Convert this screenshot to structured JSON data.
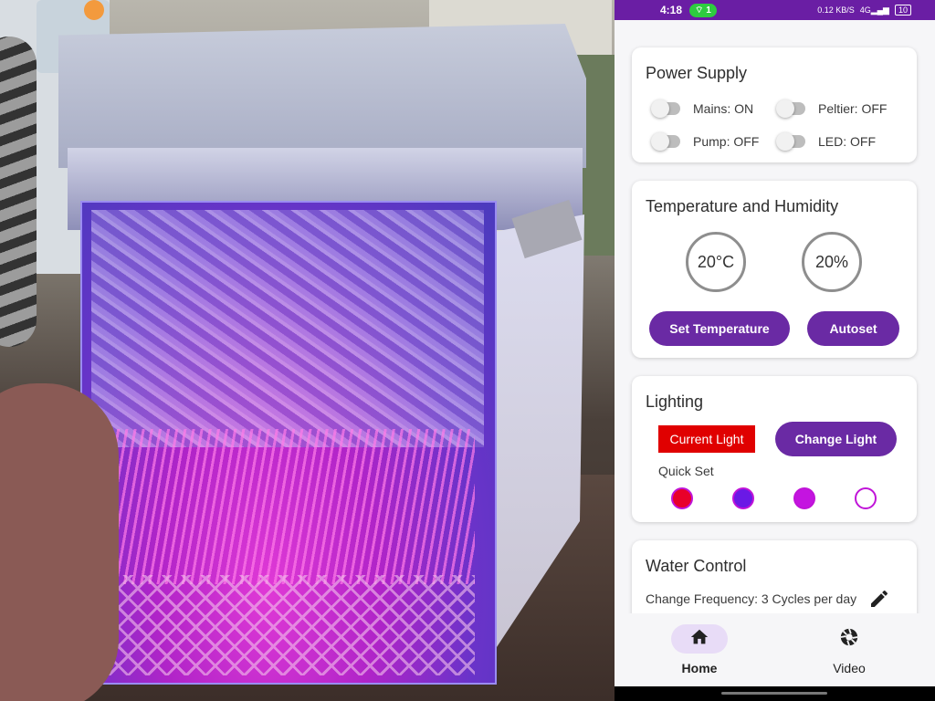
{
  "status_bar": {
    "time": "4:18",
    "hotspot_badge": "1",
    "net_speed": "0.12 KB/S",
    "signal": "4G",
    "battery": "10"
  },
  "power_supply": {
    "title": "Power Supply",
    "toggles": [
      {
        "label": "Mains: ON",
        "on": false
      },
      {
        "label": "Peltier: OFF",
        "on": false
      },
      {
        "label": "Pump: OFF",
        "on": false
      },
      {
        "label": "LED: OFF",
        "on": false
      }
    ]
  },
  "temperature_humidity": {
    "title": "Temperature and Humidity",
    "temperature": "20°C",
    "humidity": "20%",
    "set_temperature_label": "Set Temperature",
    "autoset_label": "Autoset"
  },
  "lighting": {
    "title": "Lighting",
    "current_light_label": "Current Light",
    "current_light_color": "#e00000",
    "change_light_label": "Change Light",
    "quick_set_label": "Quick Set",
    "quick_set_colors": [
      "#e8002a",
      "#6a19e6",
      "#c414e0",
      "#ffffff"
    ]
  },
  "water_control": {
    "title": "Water Control",
    "frequency_text": "Change Frequency: 3 Cycles per day"
  },
  "bottom_nav": {
    "items": [
      {
        "label": "Home",
        "icon": "home-icon",
        "active": true
      },
      {
        "label": "Video",
        "icon": "aperture-icon",
        "active": false
      }
    ]
  },
  "colors": {
    "accent": "#6a2aa4",
    "status_bar": "#6a1ea4",
    "nav_active_pill": "#e8dcf7"
  }
}
